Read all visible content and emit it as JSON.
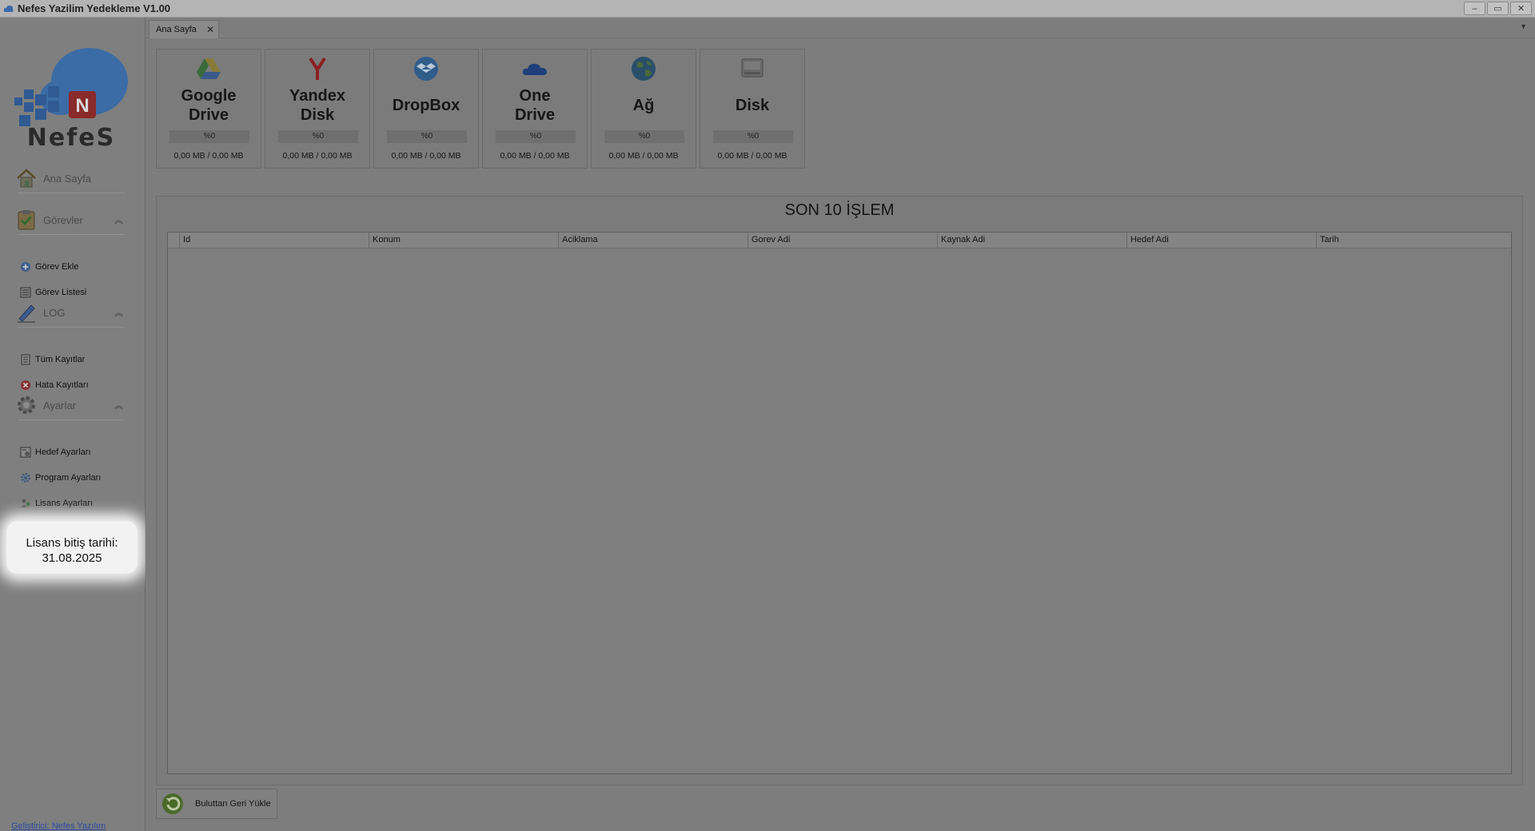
{
  "window": {
    "title": "Nefes Yazilim Yedekleme V1.00",
    "buttons": [
      "–",
      "▭",
      "✕"
    ]
  },
  "sidebar": {
    "logo_text": "NefeS",
    "logo_badge": "N",
    "home_label": "Ana Sayfa",
    "groups": [
      {
        "label": "Görevler",
        "icon": "clipboard-check-icon",
        "items": [
          {
            "label": "Görev Ekle",
            "icon": "add-circle-icon"
          },
          {
            "label": "Görev Listesi",
            "icon": "list-icon"
          }
        ]
      },
      {
        "label": "LOG",
        "icon": "pencil-icon",
        "items": [
          {
            "label": "Tüm Kayıtlar",
            "icon": "document-icon"
          },
          {
            "label": "Hata Kayıtları",
            "icon": "error-icon"
          }
        ]
      },
      {
        "label": "Ayarlar",
        "icon": "gear-icon",
        "items": [
          {
            "label": "Hedef Ayarları",
            "icon": "target-settings-icon"
          },
          {
            "label": "Program Ayarları",
            "icon": "gear-small-icon"
          },
          {
            "label": "Lisans Ayarları",
            "icon": "users-icon"
          }
        ]
      }
    ],
    "license_label": "Lisans bitiş tarihi:",
    "license_date": "31.08.2025",
    "developer_link": "Geliştirici: Nefes Yazılım"
  },
  "tabs": [
    {
      "label": "Ana Sayfa",
      "close": "✕"
    }
  ],
  "tab_menu_glyph": "▼",
  "cards": [
    {
      "name_line1": "Google",
      "name_line2": "Drive",
      "percent": "%0",
      "size": "0,00 MB / 0,00 MB",
      "icon": "google-drive-icon"
    },
    {
      "name_line1": "Yandex",
      "name_line2": "Disk",
      "percent": "%0",
      "size": "0,00 MB / 0,00 MB",
      "icon": "yandex-icon"
    },
    {
      "name_line1": "DropBox",
      "name_line2": "",
      "percent": "%0",
      "size": "0,00 MB / 0,00 MB",
      "icon": "dropbox-icon"
    },
    {
      "name_line1": "One",
      "name_line2": "Drive",
      "percent": "%0",
      "size": "0,00 MB / 0,00 MB",
      "icon": "onedrive-icon"
    },
    {
      "name_line1": "Ağ",
      "name_line2": "",
      "percent": "%0",
      "size": "0,00 MB / 0,00 MB",
      "icon": "globe-icon"
    },
    {
      "name_line1": "Disk",
      "name_line2": "",
      "percent": "%0",
      "size": "0,00 MB / 0,00 MB",
      "icon": "hard-disk-icon"
    }
  ],
  "recent": {
    "title": "SON 10 İŞLEM",
    "columns": [
      "Id",
      "Konum",
      "Aciklama",
      "Gorev Adi",
      "Kaynak Adi",
      "Hedef Adi",
      "Tarih"
    ],
    "rows": []
  },
  "restore_button": {
    "label": "Buluttan Geri Yükle",
    "icon": "restore-icon"
  }
}
